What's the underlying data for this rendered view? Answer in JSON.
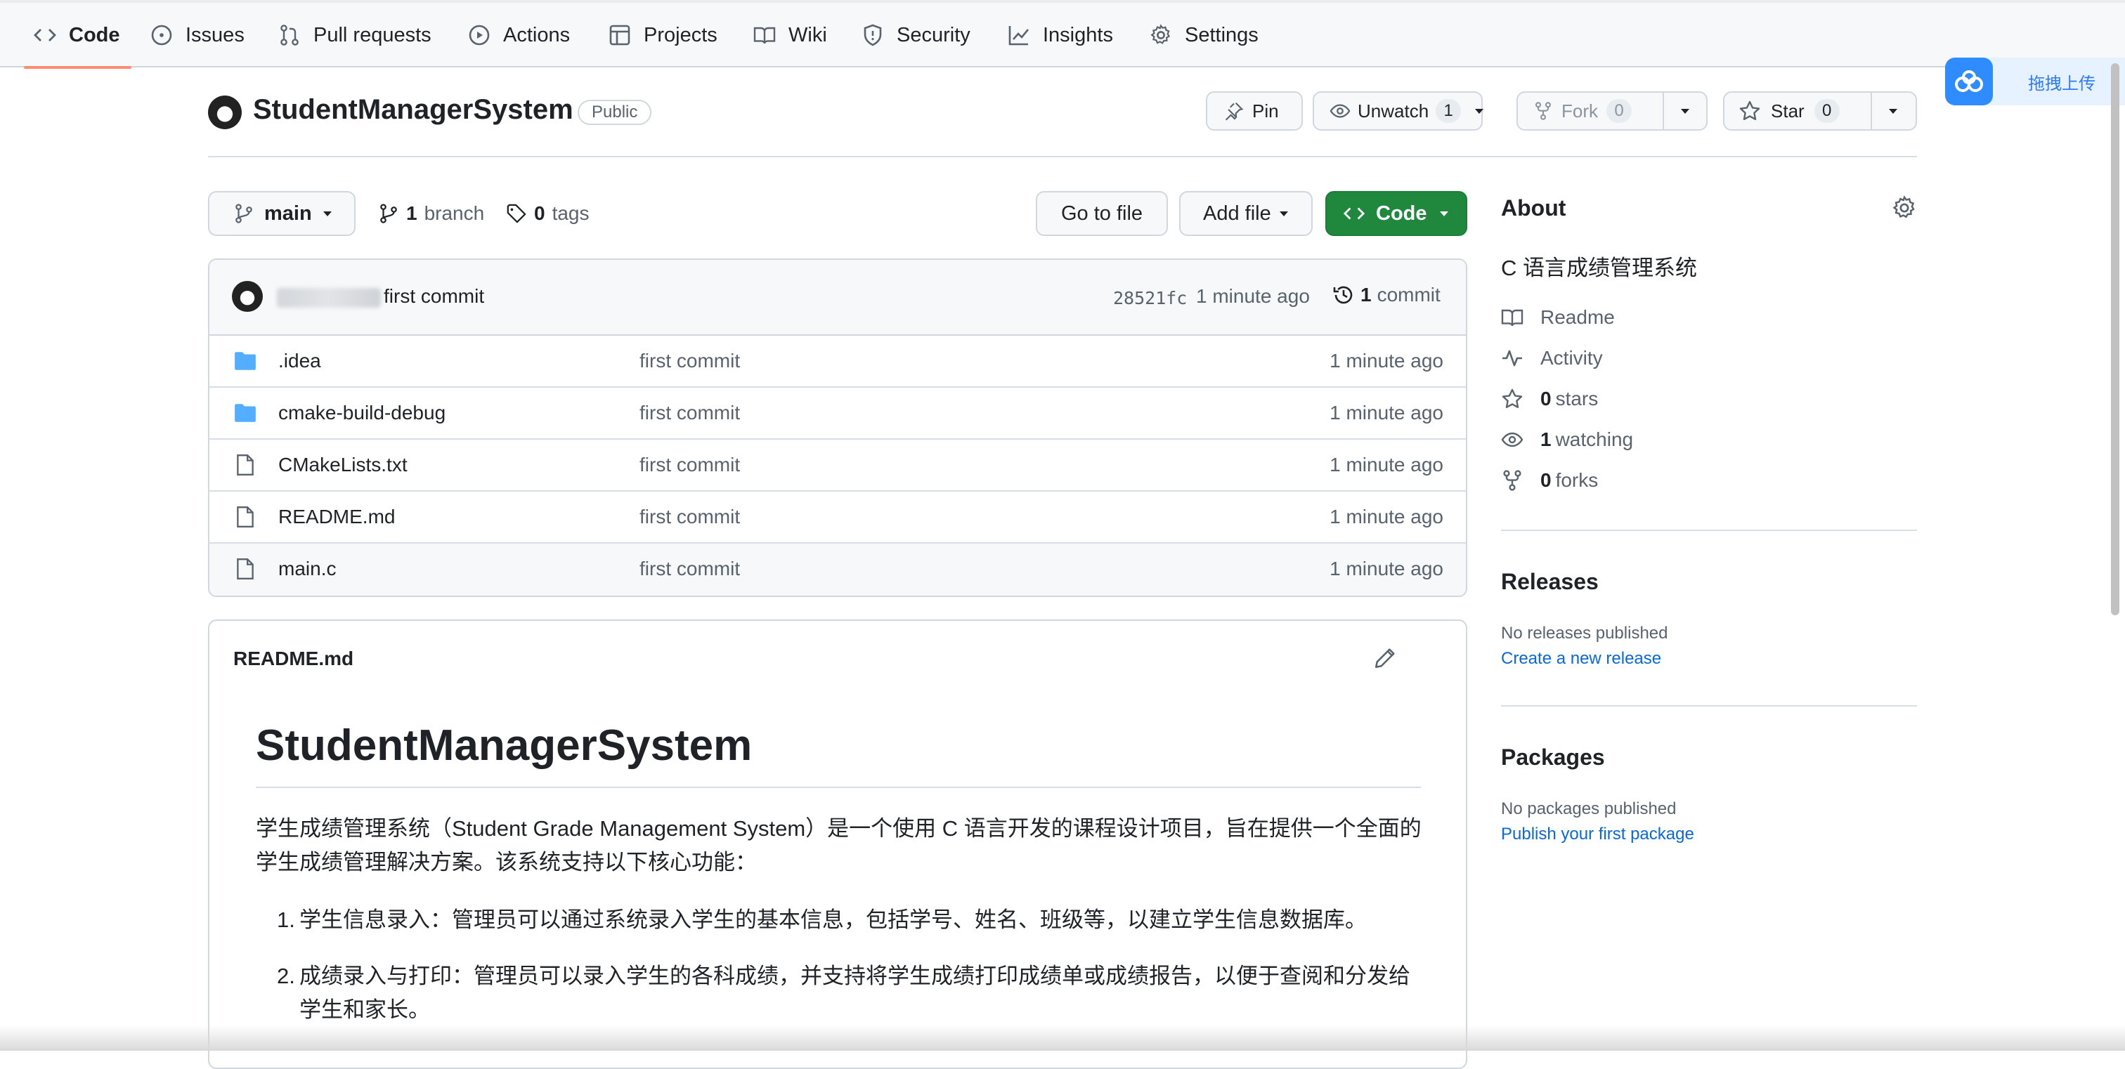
{
  "nav": {
    "tabs": [
      {
        "label": "Code",
        "icon": "code-icon"
      },
      {
        "label": "Issues",
        "icon": "issue-icon"
      },
      {
        "label": "Pull requests",
        "icon": "pull-request-icon"
      },
      {
        "label": "Actions",
        "icon": "play-icon"
      },
      {
        "label": "Projects",
        "icon": "table-icon"
      },
      {
        "label": "Wiki",
        "icon": "book-icon"
      },
      {
        "label": "Security",
        "icon": "shield-icon"
      },
      {
        "label": "Insights",
        "icon": "graph-icon"
      },
      {
        "label": "Settings",
        "icon": "gear-icon"
      }
    ],
    "active_tab": "Code"
  },
  "upload_widget": {
    "label": "拖拽上传"
  },
  "repo": {
    "name": "StudentManagerSystem",
    "visibility": "Public",
    "pin_label": "Pin",
    "unwatch_label": "Unwatch",
    "watch_count": "1",
    "fork_label": "Fork",
    "fork_count": "0",
    "star_label": "Star",
    "star_count": "0"
  },
  "toolbar": {
    "branch": "main",
    "branch_count": "1",
    "branch_label": "branch",
    "tag_count": "0",
    "tag_label": "tags",
    "goto_file": "Go to file",
    "add_file": "Add file",
    "code_button": "Code"
  },
  "latest_commit": {
    "message": "first commit",
    "sha": "28521fc",
    "time": "1 minute ago",
    "commit_count": "1",
    "commit_label": "commit"
  },
  "files": [
    {
      "name": ".idea",
      "type": "folder",
      "message": "first commit",
      "time": "1 minute ago"
    },
    {
      "name": "cmake-build-debug",
      "type": "folder",
      "message": "first commit",
      "time": "1 minute ago"
    },
    {
      "name": "CMakeLists.txt",
      "type": "file",
      "message": "first commit",
      "time": "1 minute ago"
    },
    {
      "name": "README.md",
      "type": "file",
      "message": "first commit",
      "time": "1 minute ago"
    },
    {
      "name": "main.c",
      "type": "file",
      "message": "first commit",
      "time": "1 minute ago"
    }
  ],
  "readme": {
    "filename": "README.md",
    "title": "StudentManagerSystem",
    "intro": "学生成绩管理系统（Student Grade Management System）是一个使用 C 语言开发的课程设计项目，旨在提供一个全面的学生成绩管理解决方案。该系统支持以下核心功能：",
    "items": [
      {
        "num": "1.",
        "text": "学生信息录入：管理员可以通过系统录入学生的基本信息，包括学号、姓名、班级等，以建立学生信息数据库。"
      },
      {
        "num": "2.",
        "text": "成绩录入与打印：管理员可以录入学生的各科成绩，并支持将学生成绩打印成绩单或成绩报告，以便于查阅和分发给学生和家长。"
      }
    ]
  },
  "about": {
    "heading": "About",
    "description": "C 语言成绩管理系统",
    "readme_label": "Readme",
    "activity_label": "Activity",
    "stars_count": "0",
    "stars_label": "stars",
    "watching_count": "1",
    "watching_label": "watching",
    "forks_count": "0",
    "forks_label": "forks"
  },
  "releases": {
    "heading": "Releases",
    "empty": "No releases published",
    "link": "Create a new release"
  },
  "packages": {
    "heading": "Packages",
    "empty": "No packages published",
    "link": "Publish your first package"
  },
  "colors": {
    "accent_green": "#1f883d",
    "link_blue": "#0969da",
    "active_tab_underline": "#fd8c73",
    "folder_blue": "#54aeff"
  }
}
